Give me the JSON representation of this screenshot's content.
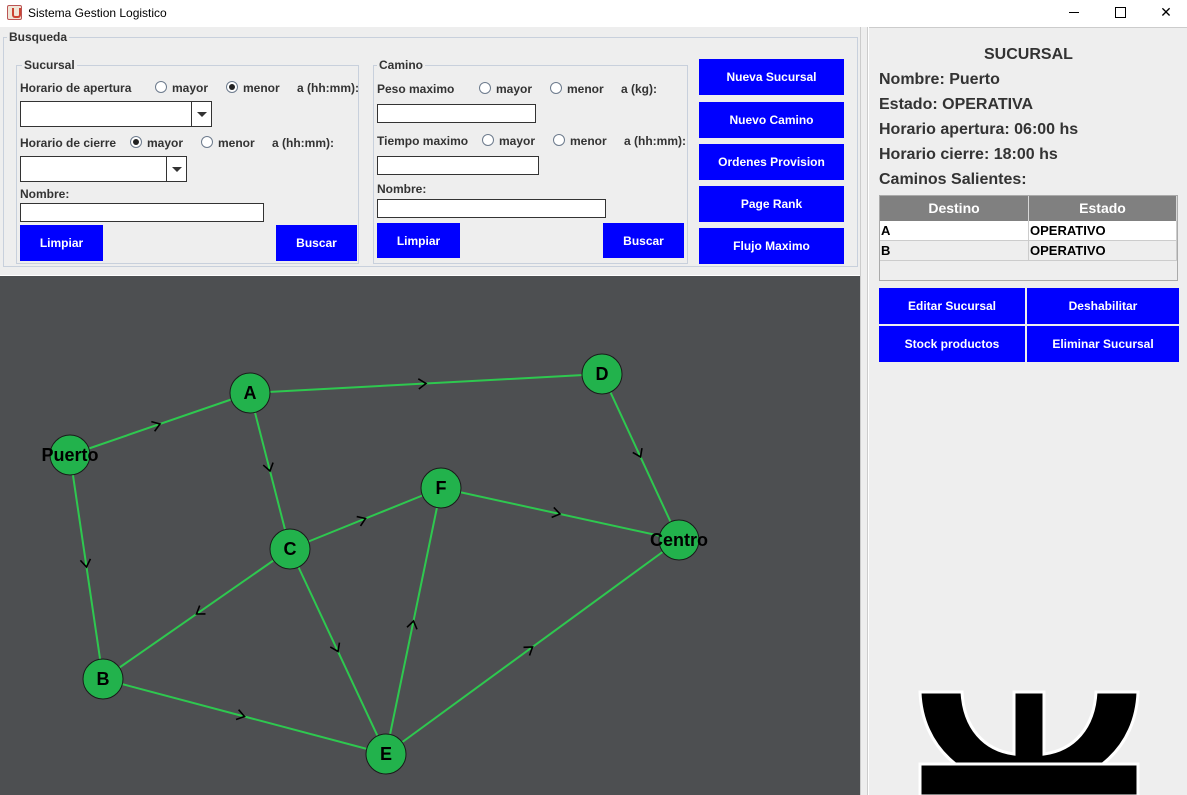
{
  "window": {
    "title": "Sistema Gestion Logistico",
    "min_icon": "minimize-icon",
    "max_icon": "maximize-icon",
    "close_glyph": "✕"
  },
  "busqueda": {
    "legend": "Busqueda",
    "sucursal": {
      "legend": "Sucursal",
      "apertura_label": "Horario de apertura",
      "apertura_mayor": "mayor",
      "apertura_menor": "menor",
      "apertura_selected": "menor",
      "apertura_suffix": "a (hh:mm):",
      "apertura_value": "",
      "cierre_label": "Horario de cierre",
      "cierre_mayor": "mayor",
      "cierre_menor": "menor",
      "cierre_selected": "mayor",
      "cierre_suffix": "a (hh:mm):",
      "cierre_value": "",
      "nombre_label": "Nombre:",
      "nombre_value": "",
      "limpiar": "Limpiar",
      "buscar": "Buscar"
    },
    "camino": {
      "legend": "Camino",
      "peso_label": "Peso maximo",
      "peso_mayor": "mayor",
      "peso_menor": "menor",
      "peso_suffix": "a (kg):",
      "peso_value": "",
      "tiempo_label": "Tiempo maximo",
      "tiempo_mayor": "mayor",
      "tiempo_menor": "menor",
      "tiempo_suffix": "a (hh:mm):",
      "tiempo_value": "",
      "nombre_label": "Nombre:",
      "nombre_value": "",
      "limpiar": "Limpiar",
      "buscar": "Buscar"
    }
  },
  "actions": {
    "nueva_sucursal": "Nueva Sucursal",
    "nuevo_camino": "Nuevo Camino",
    "ordenes_provision": "Ordenes Provision",
    "page_rank": "Page Rank",
    "flujo_maximo": "Flujo Maximo"
  },
  "graph": {
    "colors": {
      "background": "#4d4f51",
      "node": "#22b24c",
      "edge": "#2ec84f",
      "arrow": "#000000"
    },
    "nodes": [
      "Puerto",
      "A",
      "B",
      "C",
      "D",
      "E",
      "F",
      "Centro"
    ],
    "edges": [
      [
        "Puerto",
        "A"
      ],
      [
        "Puerto",
        "B"
      ],
      [
        "A",
        "D"
      ],
      [
        "A",
        "C"
      ],
      [
        "D",
        "Centro"
      ],
      [
        "C",
        "F"
      ],
      [
        "C",
        "B"
      ],
      [
        "C",
        "E"
      ],
      [
        "F",
        "Centro"
      ],
      [
        "B",
        "E"
      ],
      [
        "E",
        "F"
      ],
      [
        "E",
        "Centro"
      ]
    ]
  },
  "sucursal": {
    "header": "SUCURSAL",
    "nombre": "Nombre: Puerto",
    "estado": "Estado: OPERATIVA",
    "apertura": "Horario apertura: 06:00 hs",
    "cierre": "Horario cierre: 18:00 hs",
    "caminos_header": "Caminos Salientes:",
    "table": {
      "columns": [
        "Destino",
        "Estado"
      ],
      "rows": [
        [
          "A",
          "OPERATIVO"
        ],
        [
          "B",
          "OPERATIVO"
        ]
      ]
    },
    "buttons": {
      "editar": "Editar Sucursal",
      "deshabilitar": "Deshabilitar",
      "stock": "Stock productos",
      "eliminar": "Eliminar Sucursal"
    },
    "logo_icon": "utn-logo-icon"
  }
}
